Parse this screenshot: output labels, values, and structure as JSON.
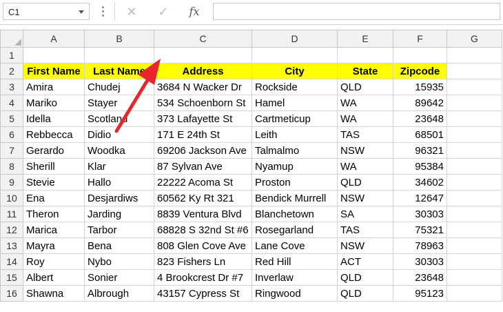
{
  "name_box": {
    "value": "C1"
  },
  "formula_bar": {
    "cancel_icon": "✕",
    "enter_icon": "✓",
    "fx_label": "fx",
    "formula": ""
  },
  "columns": [
    "A",
    "B",
    "C",
    "D",
    "E",
    "F",
    "G"
  ],
  "header_row": {
    "row": "2",
    "cells": [
      "First Name",
      "Last Name",
      "Address",
      "City",
      "State",
      "Zipcode"
    ]
  },
  "rows": [
    {
      "row": "3",
      "cells": [
        "Amira",
        "Chudej",
        "3684 N Wacker Dr",
        "Rockside",
        "QLD",
        "15935"
      ]
    },
    {
      "row": "4",
      "cells": [
        "Mariko",
        "Stayer",
        "534 Schoenborn St",
        "Hamel",
        "WA",
        "89642"
      ]
    },
    {
      "row": "5",
      "cells": [
        "Idella",
        "Scotland",
        "373 Lafayette St",
        "Cartmeticup",
        "WA",
        "23648"
      ]
    },
    {
      "row": "6",
      "cells": [
        "Rebbecca",
        "Didio",
        "171 E 24th St",
        "Leith",
        "TAS",
        "68501"
      ]
    },
    {
      "row": "7",
      "cells": [
        "Gerardo",
        "Woodka",
        "69206 Jackson Ave",
        "Talmalmo",
        "NSW",
        "96321"
      ]
    },
    {
      "row": "8",
      "cells": [
        "Sherill",
        "Klar",
        "87 Sylvan Ave",
        "Nyamup",
        "WA",
        "95384"
      ]
    },
    {
      "row": "9",
      "cells": [
        "Stevie",
        "Hallo",
        "22222 Acoma St",
        "Proston",
        "QLD",
        "34602"
      ]
    },
    {
      "row": "10",
      "cells": [
        "Ena",
        "Desjardiws",
        "60562 Ky Rt 321",
        "Bendick Murrell",
        "NSW",
        "12647"
      ]
    },
    {
      "row": "11",
      "cells": [
        "Theron",
        "Jarding",
        "8839 Ventura Blvd",
        "Blanchetown",
        "SA",
        "30303"
      ]
    },
    {
      "row": "12",
      "cells": [
        "Marica",
        "Tarbor",
        "68828 S 32nd St #6",
        "Rosegarland",
        "TAS",
        "75321"
      ]
    },
    {
      "row": "13",
      "cells": [
        "Mayra",
        "Bena",
        "808 Glen Cove Ave",
        "Lane Cove",
        "NSW",
        "78963"
      ]
    },
    {
      "row": "14",
      "cells": [
        "Roy",
        "Nybo",
        "823 Fishers Ln",
        "Red Hill",
        "ACT",
        "30303"
      ]
    },
    {
      "row": "15",
      "cells": [
        "Albert",
        "Sonier",
        "4 Brookcrest Dr #7",
        "Inverlaw",
        "QLD",
        "23648"
      ]
    },
    {
      "row": "16",
      "cells": [
        "Shawna",
        "Albrough",
        "43157 Cypress St",
        "Ringwood",
        "QLD",
        "95123"
      ]
    }
  ],
  "annotation": {
    "icon": "red-arrow-icon",
    "color": "#e8262b"
  }
}
